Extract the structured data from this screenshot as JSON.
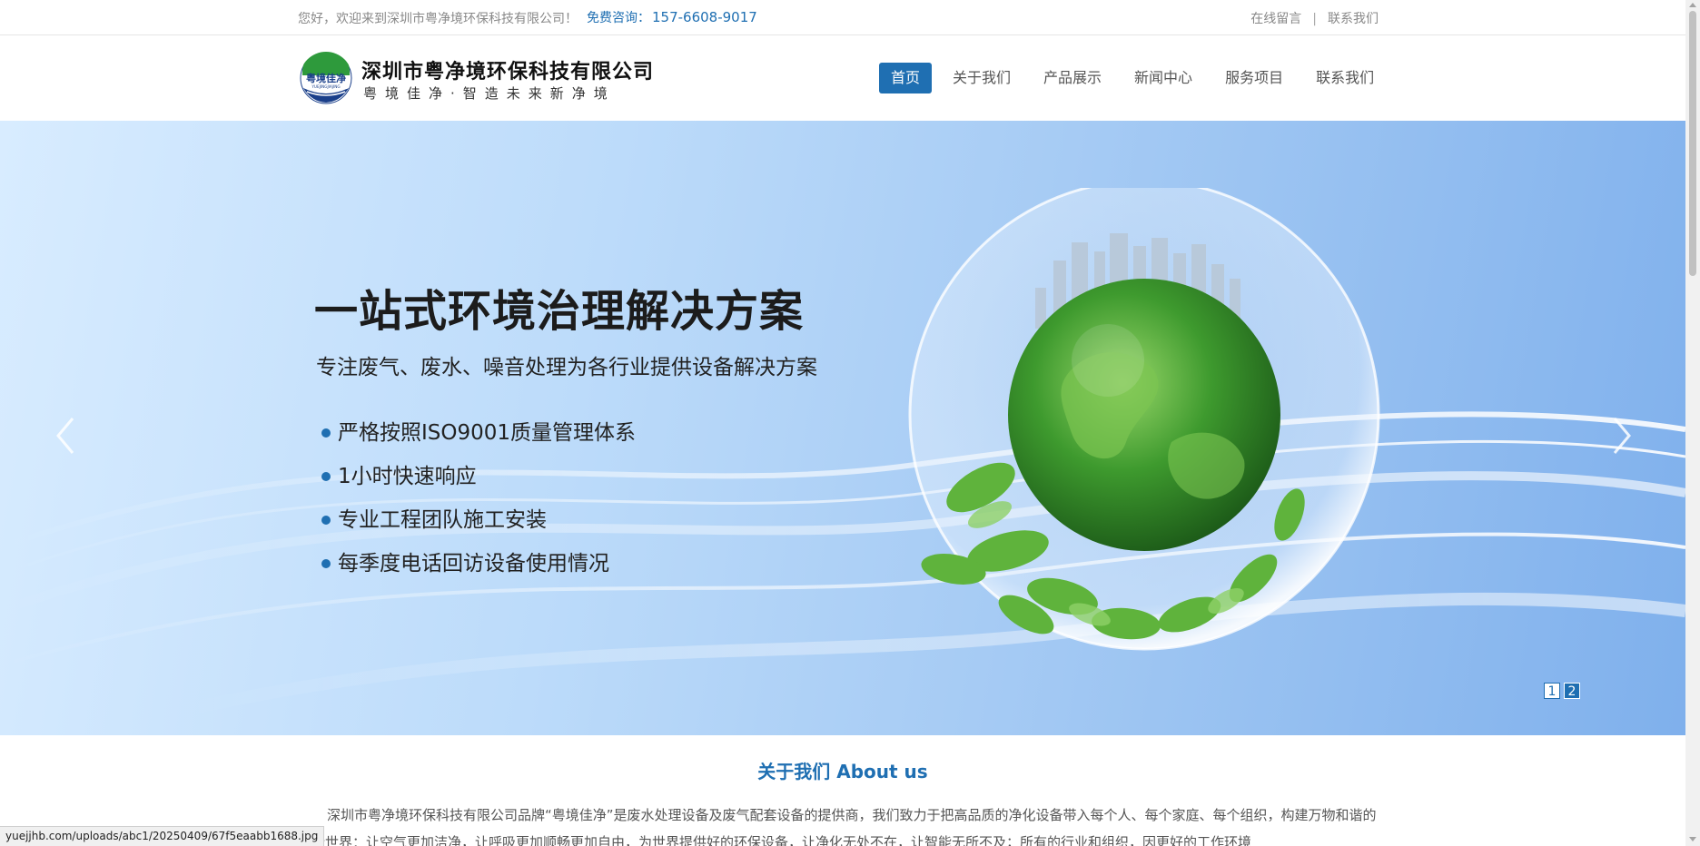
{
  "topbar": {
    "welcome": "您好，欢迎来到深圳市粤净境环保科技有限公司！",
    "hotline_label": "免费咨询：",
    "hotline_number": "157-6608-9017",
    "links": [
      "在线留言",
      "联系我们"
    ]
  },
  "header": {
    "logo_cn": "粤境佳净",
    "logo_en": "YUEJINGJIAJING",
    "company_name": "深圳市粤净境环保科技有限公司",
    "slogan": "粤境佳净·智造未来新净境",
    "nav": [
      "首页",
      "关于我们",
      "产品展示",
      "新闻中心",
      "服务项目",
      "联系我们"
    ],
    "active_nav": 0
  },
  "banner": {
    "headline": "一站式环境治理解决方案",
    "subline": "专注废气、废水、噪音处理为各行业提供设备解决方案",
    "bullets": [
      "严格按照ISO9001质量管理体系",
      "1小时快速响应",
      "专业工程团队施工安装",
      "每季度电话回访设备使用情况"
    ],
    "pages": [
      "1",
      "2"
    ],
    "current_page": 1
  },
  "about": {
    "title": "关于我们 About us",
    "text": "深圳市粤净境环保科技有限公司品牌“粤境佳净”是废水处理设备及废气配套设备的提供商，我们致力于把高品质的净化设备带入每个人、每个家庭、每个组织，构建万物和谐的清新世界：让空气更加洁净，让呼吸更加顺畅更加自由，为世界提供好的环保设备，让净化无处不在，让智能无所不及；所有的行业和组织，因更好的工作环境"
  },
  "statusbar": {
    "url": "yuejjhb.com/uploads/abc1/20250409/67f5eaabb1688.jpg"
  },
  "colors": {
    "brand_blue": "#1f6fb2",
    "globe_green": "#3e9a2e"
  }
}
